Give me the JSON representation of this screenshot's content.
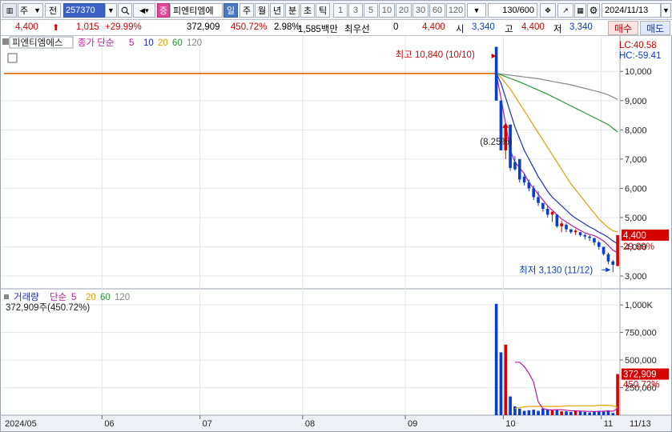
{
  "toolbar": {
    "market": "주",
    "prev_label": "전",
    "code": "257370",
    "search_icon": "search-icon",
    "company_badge": "증",
    "company_name": "피엔티엠에",
    "periods": [
      "일",
      "주",
      "월",
      "년",
      "분",
      "초",
      "틱"
    ],
    "active_period": "일",
    "intervals": [
      "1",
      "3",
      "5",
      "10",
      "20",
      "30",
      "60",
      "120"
    ],
    "count": "130/600",
    "date": "2024/11/13"
  },
  "quote": {
    "price": "4,400",
    "change": "1,015",
    "change_pct": "+29.99%",
    "volume": "372,909",
    "volume_ratio": "450.72%",
    "turnover": "2.98%",
    "amount": "1,585백만",
    "priority_label": "최우선",
    "priority_value": "0",
    "ask": "4,400",
    "open_label": "시",
    "open": "3,340",
    "high_label": "고",
    "high": "4,400",
    "low_label": "저",
    "low": "3,340",
    "buy_label": "매수",
    "sell_label": "매도"
  },
  "price_panel": {
    "title": "피엔티엠에스",
    "ma_label": "종가 단순",
    "ma_periods": [
      "5",
      "10",
      "20",
      "60",
      "120"
    ],
    "lc": "LC:40.58",
    "hc": "HC:-59.41",
    "max_label": "최고 10,840 (10/10)",
    "min_label": "최저 3,130 (11/12)",
    "pct_note": "(8.25%)",
    "last_price": "4,400",
    "last_pct": "29.99%",
    "y_ticks": [
      "10,000",
      "9,000",
      "8,000",
      "7,000",
      "6,000",
      "5,000",
      "4,000",
      "3,000"
    ]
  },
  "volume_panel": {
    "title": "거래량",
    "ma_label": "단순",
    "ma_periods": [
      "5",
      "20",
      "60",
      "120"
    ],
    "info": "372,909주(450.72%)",
    "last_volume": "372,909",
    "last_pct": "450.72%",
    "y_ticks": [
      "1,000K",
      "750,000",
      "500,000",
      "250,000"
    ]
  },
  "x_axis": [
    "2024/05",
    "06",
    "07",
    "08",
    "09",
    "10",
    "11",
    "11/13"
  ],
  "colors": {
    "up": "#d60000",
    "down": "#0a3dc8",
    "ma5": "#c0189a",
    "ma10": "#1a2fc0",
    "ma20": "#e0a000",
    "ma60": "#2a9a3a",
    "ma120": "#888888",
    "flat": "#e06a00"
  },
  "chart_data": {
    "type": "candlestick",
    "title": "피엔티엠에스",
    "ylim": [
      2700,
      10800
    ],
    "flat_line": 9930,
    "candles": [
      {
        "o": 10840,
        "h": 10840,
        "l": 9000,
        "c": 9000
      },
      {
        "o": 9000,
        "h": 9000,
        "l": 7300,
        "c": 7300
      },
      {
        "o": 7300,
        "h": 8180,
        "l": 7000,
        "c": 8180
      },
      {
        "o": 8180,
        "h": 8180,
        "l": 6600,
        "c": 6700
      },
      {
        "o": 6900,
        "h": 7100,
        "l": 6600,
        "c": 6650
      },
      {
        "o": 7000,
        "h": 7000,
        "l": 6200,
        "c": 6300
      },
      {
        "o": 6400,
        "h": 6500,
        "l": 6100,
        "c": 6200
      },
      {
        "o": 6200,
        "h": 6300,
        "l": 5900,
        "c": 6000
      },
      {
        "o": 6000,
        "h": 6100,
        "l": 5600,
        "c": 5700
      },
      {
        "o": 5700,
        "h": 5900,
        "l": 5400,
        "c": 5500
      },
      {
        "o": 5500,
        "h": 5500,
        "l": 5200,
        "c": 5300
      },
      {
        "o": 5300,
        "h": 5400,
        "l": 5000,
        "c": 5100
      },
      {
        "o": 5100,
        "h": 5200,
        "l": 4850,
        "c": 5200
      },
      {
        "o": 5100,
        "h": 5100,
        "l": 4650,
        "c": 4700
      },
      {
        "o": 4700,
        "h": 4900,
        "l": 4500,
        "c": 4800
      },
      {
        "o": 4750,
        "h": 4800,
        "l": 4500,
        "c": 4600
      },
      {
        "o": 4600,
        "h": 4600,
        "l": 4450,
        "c": 4500
      },
      {
        "o": 4500,
        "h": 4600,
        "l": 4400,
        "c": 4550
      },
      {
        "o": 4500,
        "h": 4500,
        "l": 4350,
        "c": 4400
      },
      {
        "o": 4400,
        "h": 4450,
        "l": 4250,
        "c": 4350
      },
      {
        "o": 4350,
        "h": 4400,
        "l": 4200,
        "c": 4300
      },
      {
        "o": 4300,
        "h": 4300,
        "l": 4050,
        "c": 4150
      },
      {
        "o": 4150,
        "h": 4200,
        "l": 3900,
        "c": 4000
      },
      {
        "o": 4000,
        "h": 4000,
        "l": 3700,
        "c": 3750
      },
      {
        "o": 3750,
        "h": 3800,
        "l": 3400,
        "c": 3500
      },
      {
        "o": 3500,
        "h": 3550,
        "l": 3130,
        "c": 3385
      },
      {
        "o": 3340,
        "h": 4400,
        "l": 3340,
        "c": 4400
      }
    ],
    "ma5": [
      9930,
      9100,
      8200,
      7300,
      6900,
      6700,
      6500,
      6200,
      6000,
      5800,
      5600,
      5400,
      5250,
      5100,
      4950,
      4850,
      4750,
      4650,
      4560,
      4480,
      4420,
      4380,
      4300,
      4200,
      4050,
      3880,
      3800
    ],
    "ma10": [
      9930,
      9600,
      9100,
      8600,
      8100,
      7700,
      7300,
      7000,
      6700,
      6400,
      6150,
      5900,
      5700,
      5550,
      5400,
      5250,
      5100,
      4980,
      4880,
      4780,
      4680,
      4600,
      4500,
      4420,
      4320,
      4200,
      4100
    ],
    "ma20": [
      9930,
      9800,
      9600,
      9400,
      9150,
      8900,
      8650,
      8400,
      8150,
      7900,
      7650,
      7400,
      7150,
      6900,
      6650,
      6400,
      6150,
      5950,
      5750,
      5550,
      5350,
      5150,
      4950,
      4800,
      4650,
      4550,
      4500
    ],
    "ma60": [
      9930,
      9880,
      9820,
      9760,
      9700,
      9640,
      9570,
      9500,
      9430,
      9360,
      9290,
      9220,
      9140,
      9060,
      8980,
      8900,
      8820,
      8740,
      8660,
      8580,
      8500,
      8420,
      8340,
      8260,
      8180,
      8050,
      7930
    ],
    "ma120": [
      9930,
      9910,
      9890,
      9870,
      9850,
      9830,
      9810,
      9790,
      9770,
      9750,
      9720,
      9690,
      9660,
      9630,
      9600,
      9570,
      9540,
      9500,
      9460,
      9420,
      9380,
      9340,
      9300,
      9250,
      9200,
      9120,
      9040
    ],
    "volume": {
      "ylim": [
        0,
        1030000
      ],
      "values": [
        1010000,
        570000,
        640000,
        170000,
        80000,
        60000,
        40000,
        45000,
        50000,
        40000,
        60000,
        55000,
        45000,
        50000,
        35000,
        35000,
        30000,
        40000,
        35000,
        30000,
        25000,
        35000,
        40000,
        35000,
        45000,
        20000,
        372909
      ],
      "ma5": [
        0,
        0,
        0,
        0,
        480000,
        480000,
        440000,
        380000,
        300000,
        120000,
        60000,
        50000,
        48000,
        50000,
        50000,
        45000,
        40000,
        40000,
        38000,
        36000,
        34000,
        34000,
        34000,
        36000,
        38000,
        36000,
        60000
      ],
      "ma20": [
        0,
        0,
        0,
        0,
        60000,
        70000,
        75000,
        80000,
        80000,
        80000,
        80000,
        80000,
        80000,
        80000,
        80000,
        85000,
        85000,
        85000,
        85000,
        85000,
        85000,
        85000,
        90000,
        90000,
        90000,
        85000,
        70000
      ]
    }
  }
}
